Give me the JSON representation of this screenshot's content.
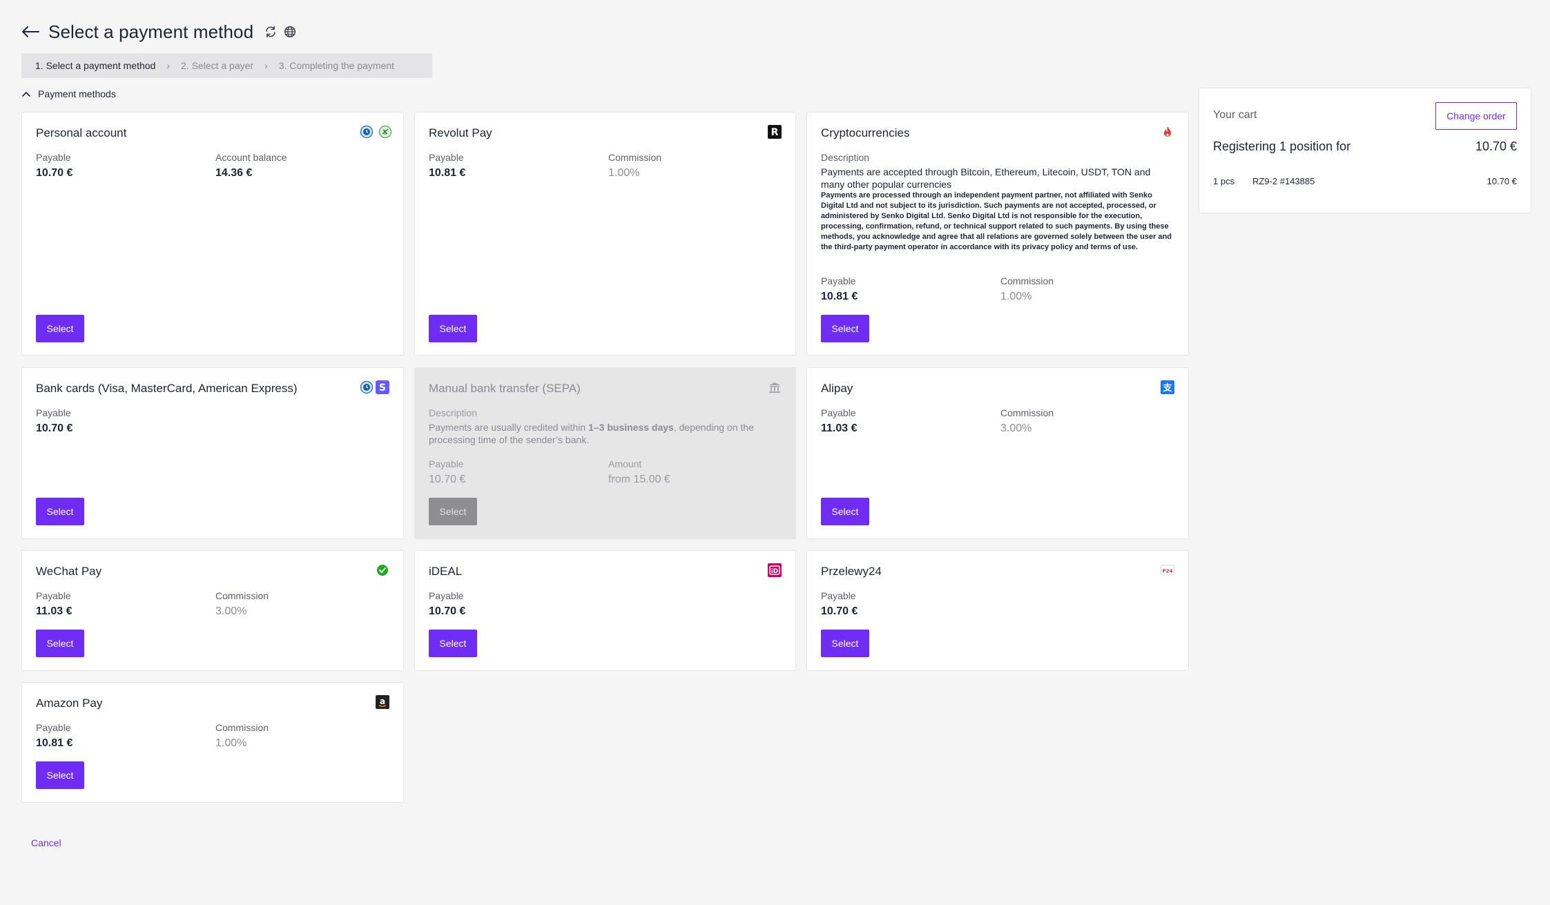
{
  "header": {
    "title": "Select a payment method"
  },
  "stepper": {
    "steps": [
      "1. Select a payment method",
      "2. Select a payer",
      "3. Completing the payment"
    ]
  },
  "section": {
    "label": "Payment methods"
  },
  "methods": {
    "personal_account": {
      "title": "Personal account",
      "payable_label": "Payable",
      "payable_value": "10.70 €",
      "balance_label": "Account balance",
      "balance_value": "14.36 €",
      "select": "Select"
    },
    "revolut": {
      "title": "Revolut Pay",
      "payable_label": "Payable",
      "payable_value": "10.81 €",
      "commission_label": "Commission",
      "commission_value": "1.00%",
      "select": "Select"
    },
    "crypto": {
      "title": "Cryptocurrencies",
      "description_label": "Description",
      "description": "Payments are accepted through Bitcoin, Ethereum, Litecoin, USDT, TON and many other popular currencies",
      "disclaimer": "Payments are processed through an independent payment partner, not affiliated with Senko Digital Ltd and not subject to its jurisdiction. Such payments are not accepted, processed, or administered by Senko Digital Ltd. Senko Digital Ltd is not responsible for the execution, processing, confirmation, refund, or technical support related to such payments. By using these methods, you acknowledge and agree that all relations are governed solely between the user and the third-party payment operator in accordance with its privacy policy and terms of use.",
      "payable_label": "Payable",
      "payable_value": "10.81 €",
      "commission_label": "Commission",
      "commission_value": "1.00%",
      "select": "Select"
    },
    "bank_cards": {
      "title": "Bank cards (Visa, MasterCard, American Express)",
      "payable_label": "Payable",
      "payable_value": "10.70 €",
      "select": "Select"
    },
    "sepa": {
      "title": "Manual bank transfer (SEPA)",
      "description_label": "Description",
      "description_pre": "Payments are usually credited within ",
      "description_bold": "1–3 business days",
      "description_post": ", depending on the processing time of the sender’s bank.",
      "payable_label": "Payable",
      "payable_value": "10.70 €",
      "amount_label": "Amount",
      "amount_value": "from 15.00 €",
      "select": "Select"
    },
    "alipay": {
      "title": "Alipay",
      "payable_label": "Payable",
      "payable_value": "11.03 €",
      "commission_label": "Commission",
      "commission_value": "3.00%",
      "select": "Select"
    },
    "wechat": {
      "title": "WeChat Pay",
      "payable_label": "Payable",
      "payable_value": "11.03 €",
      "commission_label": "Commission",
      "commission_value": "3.00%",
      "select": "Select"
    },
    "ideal": {
      "title": "iDEAL",
      "payable_label": "Payable",
      "payable_value": "10.70 €",
      "select": "Select"
    },
    "przelewy": {
      "title": "Przelewy24",
      "payable_label": "Payable",
      "payable_value": "10.70 €",
      "select": "Select"
    },
    "amazon": {
      "title": "Amazon Pay",
      "payable_label": "Payable",
      "payable_value": "10.81 €",
      "commission_label": "Commission",
      "commission_value": "1.00%",
      "select": "Select"
    }
  },
  "cart": {
    "title": "Your cart",
    "change_order": "Change order",
    "summary_label": "Registering 1 position for",
    "summary_total": "10.70 €",
    "line_qty": "1 pcs",
    "line_item": "RZ9-2 #143885",
    "line_price": "10.70 €"
  },
  "cancel": "Cancel",
  "colors": {
    "accent": "#6e2cf4",
    "background": "#f5f5f5",
    "card": "#ffffff",
    "disabled_card": "#e6e6e7"
  },
  "icons": {
    "back": "arrow-left-icon",
    "refresh": "refresh-icon",
    "language": "globe-icon",
    "chevron": "chevron-up-icon",
    "step_separator": "chevron-right-icon"
  }
}
